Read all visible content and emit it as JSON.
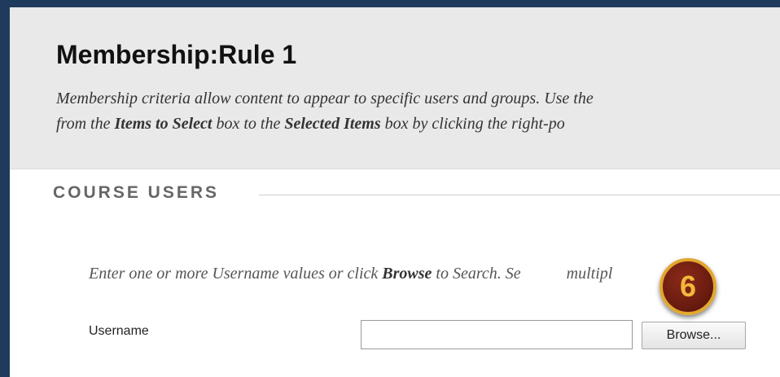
{
  "page": {
    "title": "Membership:Rule 1",
    "description": {
      "line1": "Membership criteria allow content to appear to specific users and groups. Use the",
      "line2_a": "from the ",
      "line2_b": "Items to Select",
      "line2_c": " box to the ",
      "line2_d": "Selected Items",
      "line2_e": " box by clicking the right-po"
    }
  },
  "section": {
    "title": "COURSE USERS"
  },
  "instructions": {
    "a": "Enter one or more Username values or click ",
    "b": "Browse",
    "c": " to Search. Se",
    "d": "multipl"
  },
  "username_field": {
    "label": "Username",
    "value": ""
  },
  "browse_button": {
    "label": "Browse..."
  },
  "callout": {
    "step": "6"
  },
  "colors": {
    "background_frame": "#1f3a5c",
    "header_bg": "#e9e9e9",
    "badge_fill": "#6b1c10",
    "badge_ring": "#e2a72e"
  }
}
